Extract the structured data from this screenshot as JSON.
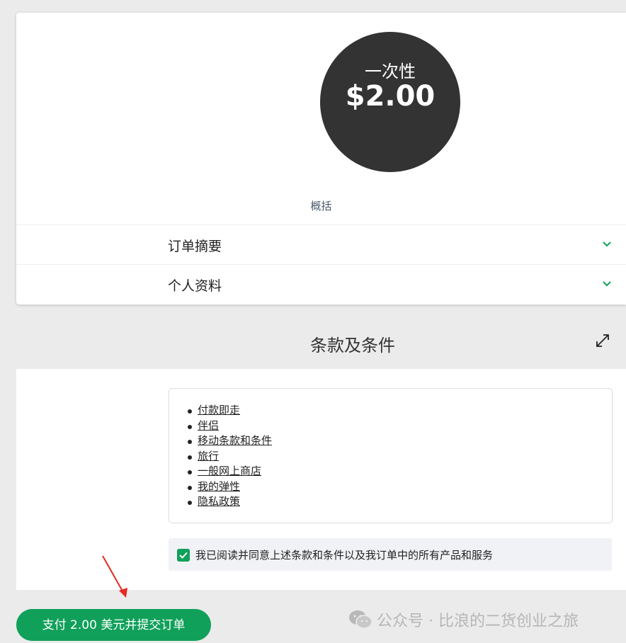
{
  "product": {
    "price_label": "一次性",
    "price_amount": "$2.00",
    "summary_link": "概括"
  },
  "accordion": [
    {
      "label": "订单摘要"
    },
    {
      "label": "个人资料"
    }
  ],
  "terms": {
    "title": "条款及条件",
    "links": [
      "付款即走",
      "伴侣",
      "移动条款和条件",
      "旅行",
      "一般网上商店",
      "我的弹性",
      "隐私政策"
    ],
    "agree_text": "我已阅读并同意上述条款和条件以及我订单中的所有产品和服务",
    "agree_checked": true
  },
  "pay_button_label": "支付 2.00 美元并提交订单",
  "watermark": "公众号 · 比浪的二货创业之旅",
  "colors": {
    "accent_green": "#10a05a",
    "price_circle": "#333333",
    "annotation_arrow": "#e52a1f"
  }
}
